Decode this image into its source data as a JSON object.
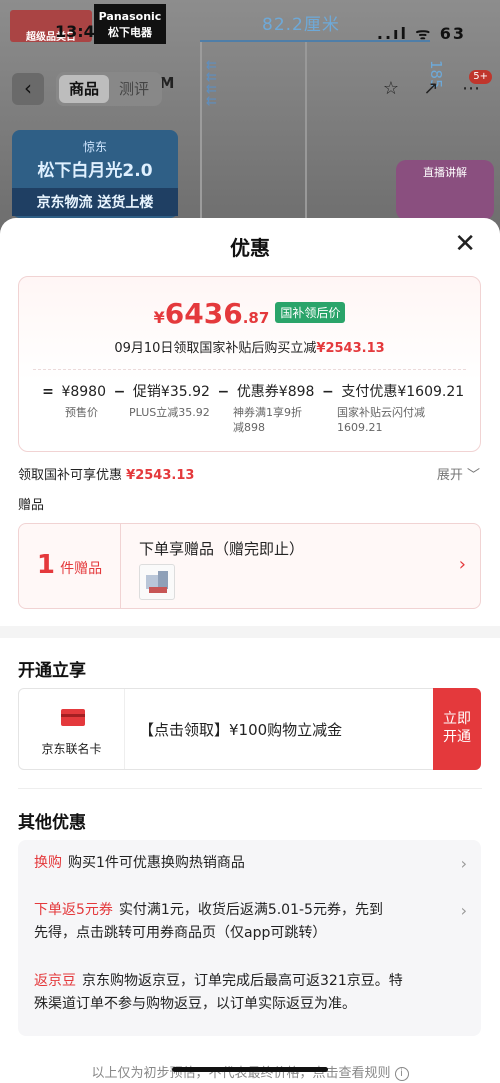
{
  "status_bar": {
    "time": "13:4",
    "right": "..ıl ᯤ 63"
  },
  "background": {
    "brand_left": "超级品类日",
    "brand_right_1": "Panasonic",
    "brand_right_2": "松下电器",
    "measure_top": "82.2厘米",
    "measure_side": "185",
    "ocm": "0CM",
    "promo": {
      "line1": "惊东",
      "line2": "松下白月光2.0",
      "line3": "京东物流 送货上楼"
    },
    "promo_right": "直播讲解"
  },
  "nav": {
    "tabs": [
      "商品",
      "测评"
    ],
    "active_tab": "商品",
    "badge": "5+"
  },
  "sheet": {
    "title": "优惠",
    "price": {
      "currency": "¥",
      "integer": "6436",
      "decimal": ".87",
      "tag": "国补领后价"
    },
    "price_sub_prefix": "09月10日领取国家补贴后购买立减",
    "price_sub_amount": "¥2543.13",
    "formula": {
      "presale": "¥8980",
      "promo": "促销¥35.92",
      "coupon": "优惠券¥898",
      "pay": "支付优惠¥1609.21",
      "ops": [
        "=",
        "−",
        "−",
        "−"
      ]
    },
    "notes": {
      "presale": "预售价",
      "promo": "PLUS立减35.92",
      "coupon_1": "神券满1享9折",
      "coupon_2": "减898",
      "pay_1": "国家补贴云闪付减",
      "pay_2": "1609.21"
    },
    "gov_prefix": "领取国补可享优惠",
    "gov_amount": "¥2543.13",
    "expand": "展开 ﹀",
    "gift_heading": "赠品",
    "gift": {
      "count": "1",
      "unit": "件赠品",
      "text": "下单享赠品（赠完即止）"
    },
    "open_heading": "开通立享",
    "card": {
      "label": "京东联名卡",
      "text": "【点击领取】¥100购物立减金",
      "btn_1": "立即",
      "btn_2": "开通"
    },
    "other_heading": "其他优惠",
    "other": [
      {
        "key": "换购",
        "text": "购买1件可优惠换购热销商品"
      },
      {
        "key": "下单返5元券",
        "text_1": "实付满1元，收货后返满5.01-5元券，先到",
        "text_2": "先得，点击跳转可用券商品页（仅app可跳转）"
      },
      {
        "key": "返京豆",
        "text_1": "京东购物返京豆，订单完成后最高可返321京豆。特",
        "text_2": "殊渠道订单不参与购物返豆，以订单实际返豆为准。"
      }
    ],
    "footer": "以上仅为初步预估，不代表最终价格，点击查看规则"
  }
}
